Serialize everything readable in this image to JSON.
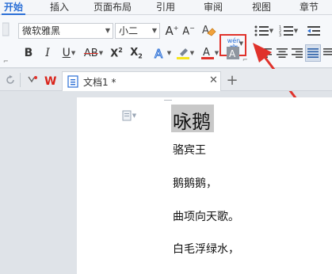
{
  "tabs": [
    {
      "label": "开始",
      "active": true
    },
    {
      "label": "插入",
      "active": false
    },
    {
      "label": "页面布局",
      "active": false
    },
    {
      "label": "引用",
      "active": false
    },
    {
      "label": "审阅",
      "active": false
    },
    {
      "label": "视图",
      "active": false
    },
    {
      "label": "章节",
      "active": false
    }
  ],
  "ribbon": {
    "font_name": "微软雅黑",
    "font_size": "小二",
    "phonetic_top": "wén",
    "phonetic_bottom": "文",
    "highlight_color": "#e0322b"
  },
  "doc_tab": {
    "title": "文档1 *"
  },
  "document": {
    "lines": [
      "咏鹅",
      "骆宾王",
      "鹅鹅鹅，",
      "曲项向天歌。",
      "白毛浮绿水，"
    ]
  },
  "colors": {
    "accent": "#2b6fd6",
    "annotation": "#e0322b",
    "selection": "#c8c8c8"
  }
}
